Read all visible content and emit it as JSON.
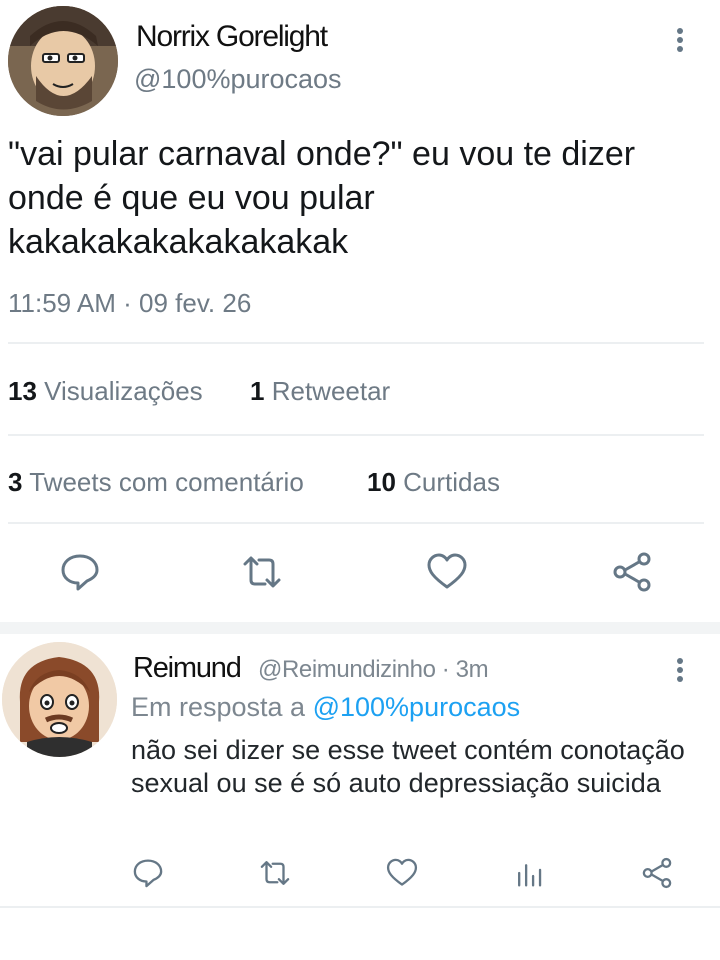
{
  "main_tweet": {
    "author_name": "Norrix Gorelight",
    "author_handle": "@100%purocaos",
    "text": "\"vai pular carnaval onde?\" eu vou te dizer onde é que eu vou pular kakakakakakakakakak",
    "timestamp": "11:59 AM · 09 fev. 26",
    "stats": {
      "views_count": "13",
      "views_label": "Visualizações",
      "retweets_count": "1",
      "retweets_label": "Retweetar",
      "quotes_count": "3",
      "quotes_label": "Tweets com comentário",
      "likes_count": "10",
      "likes_label": "Curtidas"
    },
    "actions": [
      "reply-icon",
      "retweet-icon",
      "like-icon",
      "share-icon"
    ]
  },
  "reply": {
    "author_name": "Reimund",
    "author_handle_time": "@Reimundizinho · 3m",
    "reply_to_prefix": "Em resposta a",
    "reply_to_mention": "@100%purocaos",
    "text": "não sei dizer se esse tweet contém conotação sexual ou se é só auto depressiação suicida",
    "actions": [
      "reply-icon",
      "retweet-icon",
      "like-icon",
      "analytics-icon",
      "share-icon"
    ]
  },
  "colors": {
    "text_primary": "#14171a",
    "text_secondary": "#6e7a85",
    "link": "#1da1f2",
    "divider": "#eceff1"
  }
}
